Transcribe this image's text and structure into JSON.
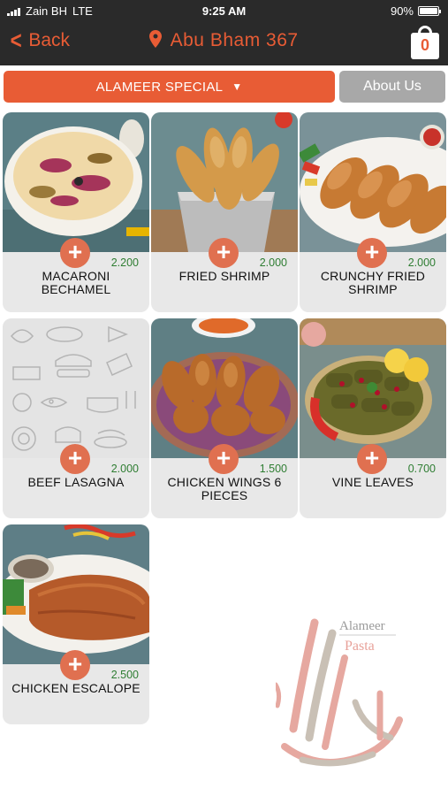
{
  "status_bar": {
    "carrier": "Zain BH",
    "network": "LTE",
    "time": "9:25 AM",
    "battery": "90%"
  },
  "nav": {
    "back_label": "Back",
    "location": "Abu Bham 367",
    "cart_count": "0"
  },
  "category": {
    "selected": "ALAMEER SPECIAL",
    "about_label": "About Us"
  },
  "menu_items": [
    {
      "name": "MACARONI BECHAMEL",
      "price": "2.200"
    },
    {
      "name": "FRIED SHRIMP",
      "price": "2.000"
    },
    {
      "name": "CRUNCHY FRIED SHRIMP",
      "price": "2.000"
    },
    {
      "name": "BEEF LASAGNA",
      "price": "2.000"
    },
    {
      "name": "CHICKEN WINGS 6 PIECES",
      "price": "1.500"
    },
    {
      "name": "VINE LEAVES",
      "price": "0.700"
    },
    {
      "name": "CHICKEN ESCALOPE",
      "price": "2.500"
    }
  ],
  "logo": {
    "line1": "Alameer",
    "line2": "Pasta"
  },
  "colors": {
    "accent": "#e85c35",
    "header_bg": "#2a2a2a",
    "price": "#2e7d32",
    "card_bg": "#e8e8e8",
    "about_bg": "#a8a8a8"
  },
  "icons": [
    "back-chevron-icon",
    "location-pin-icon",
    "shopping-bag-icon",
    "dropdown-caret-icon",
    "add-plus-icon"
  ]
}
